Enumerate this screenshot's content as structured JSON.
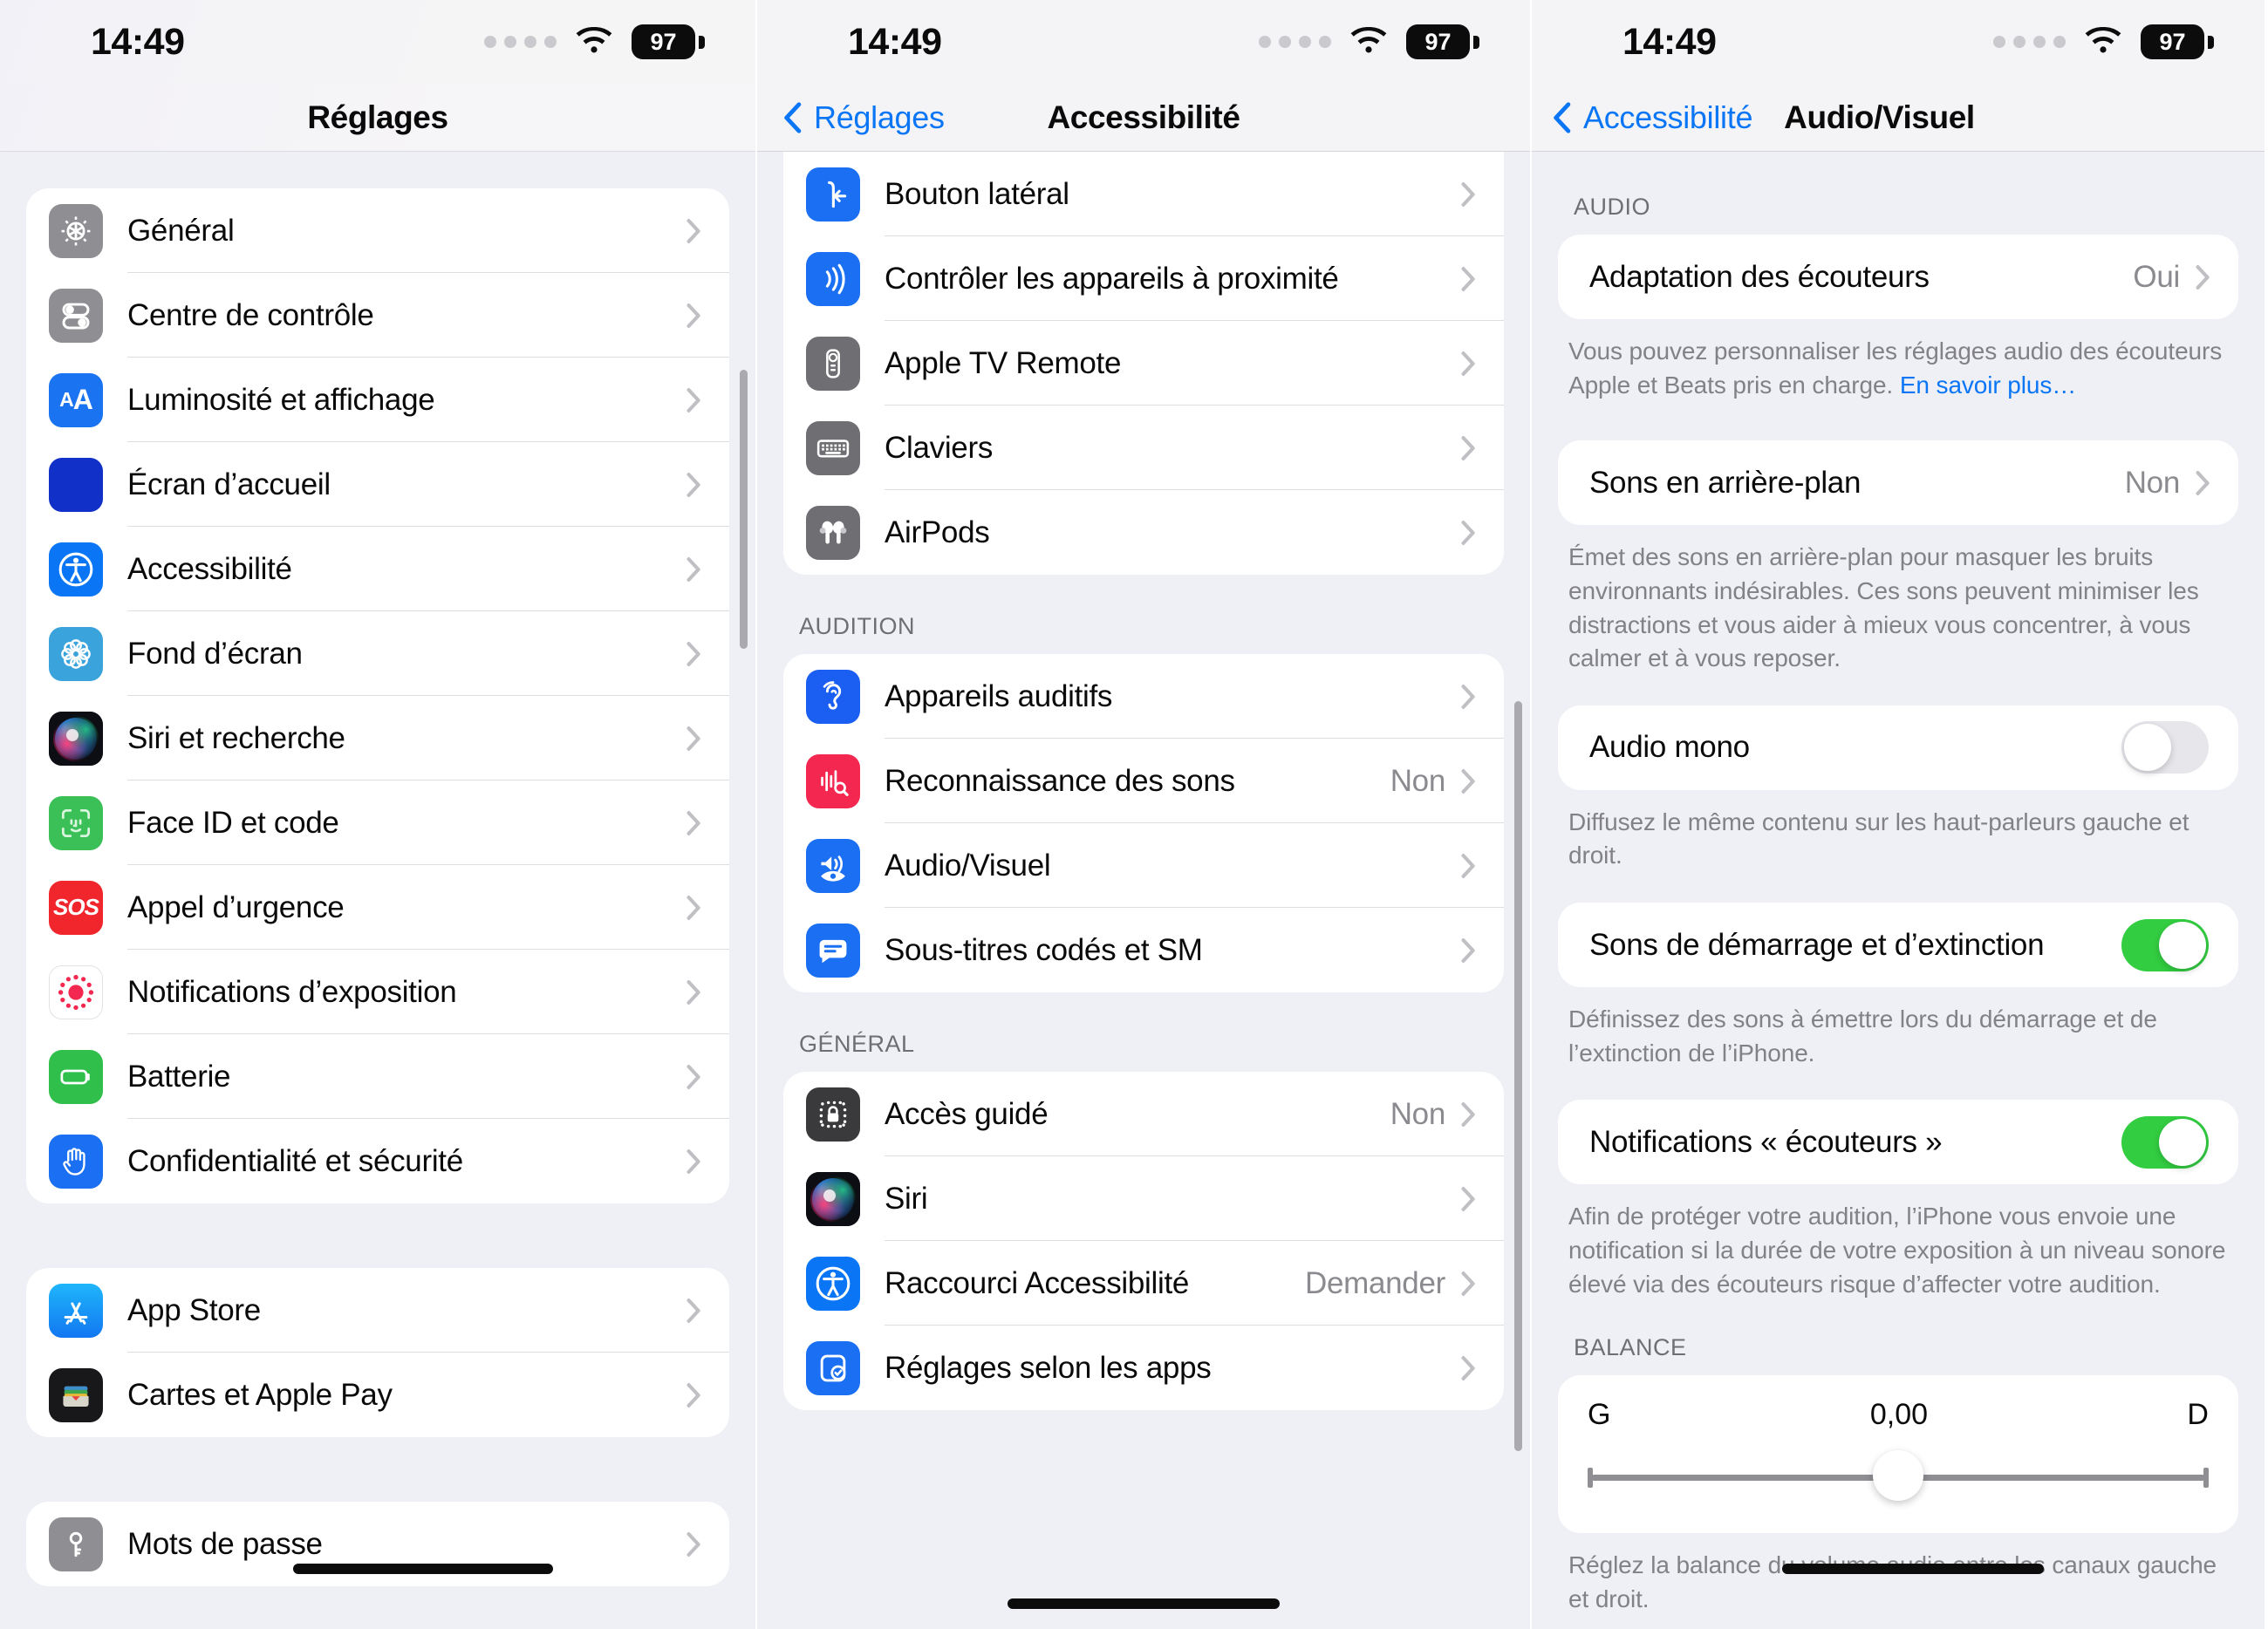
{
  "status": {
    "time": "14:49",
    "battery_percent": "97",
    "signal_dots": 4,
    "wifi_icon": "wifi-icon",
    "battery_icon": "battery-icon"
  },
  "screen1": {
    "nav": {
      "title": "Réglages"
    },
    "groups": [
      {
        "items": [
          {
            "label": "Général",
            "icon": "gear-icon",
            "icon_color": "#8e8e93"
          },
          {
            "label": "Centre de contrôle",
            "icon": "control-center-icon",
            "icon_color": "#8e8e93"
          },
          {
            "label": "Luminosité et affichage",
            "icon": "display-brightness-icon",
            "icon_color": "#1a73f0"
          },
          {
            "label": "Écran d’accueil",
            "icon": "home-screen-icon",
            "icon_color": "#1130c8"
          },
          {
            "label": "Accessibilité",
            "icon": "accessibility-icon",
            "icon_color": "#0a76f6"
          },
          {
            "label": "Fond d’écran",
            "icon": "wallpaper-icon",
            "icon_color": "#3aa3dc"
          },
          {
            "label": "Siri et recherche",
            "icon": "siri-icon",
            "icon_color": "#1c1c20"
          },
          {
            "label": "Face ID et code",
            "icon": "face-id-icon",
            "icon_color": "#3ac057"
          },
          {
            "label": "Appel d’urgence",
            "icon": "sos-icon",
            "icon_color": "#f0262c"
          },
          {
            "label": "Notifications d’exposition",
            "icon": "exposure-notifications-icon",
            "icon_color": "#ffffff"
          },
          {
            "label": "Batterie",
            "icon": "battery-settings-icon",
            "icon_color": "#2fbf4a"
          },
          {
            "label": "Confidentialité et sécurité",
            "icon": "privacy-hand-icon",
            "icon_color": "#1a6ff2"
          }
        ]
      },
      {
        "items": [
          {
            "label": "App Store",
            "icon": "app-store-icon",
            "icon_color": "#1d9bf5"
          },
          {
            "label": "Cartes et Apple Pay",
            "icon": "wallet-icon",
            "icon_color": "#1c1c1e"
          }
        ]
      },
      {
        "items": [
          {
            "label": "Mots de passe",
            "icon": "passwords-key-icon",
            "icon_color": "#8e8e93"
          }
        ]
      }
    ]
  },
  "screen2": {
    "nav": {
      "back": "Réglages",
      "title": "Accessibilité"
    },
    "group_top": {
      "items": [
        {
          "label": "Bouton latéral",
          "icon": "side-button-icon",
          "icon_color": "#1a6ff2"
        },
        {
          "label": "Contrôler les appareils à proximité",
          "icon": "nearby-devices-icon",
          "icon_color": "#1a6ff2"
        },
        {
          "label": "Apple TV Remote",
          "icon": "apple-tv-remote-icon",
          "icon_color": "#6e6e73"
        },
        {
          "label": "Claviers",
          "icon": "keyboard-icon",
          "icon_color": "#6e6e73"
        },
        {
          "label": "AirPods",
          "icon": "airpods-icon",
          "icon_color": "#6e6e73"
        }
      ]
    },
    "section_audition": {
      "header": "AUDITION",
      "items": [
        {
          "label": "Appareils auditifs",
          "value": "",
          "icon": "hearing-ear-icon",
          "icon_color": "#1a5ef2"
        },
        {
          "label": "Reconnaissance des sons",
          "value": "Non",
          "icon": "sound-recognition-icon",
          "icon_color": "#f3274f"
        },
        {
          "label": "Audio/Visuel",
          "value": "",
          "icon": "audio-visual-icon",
          "icon_color": "#1a6ff2"
        },
        {
          "label": "Sous-titres codés et SM",
          "value": "",
          "icon": "subtitles-icon",
          "icon_color": "#1a6ff2"
        }
      ]
    },
    "section_general": {
      "header": "GÉNÉRAL",
      "items": [
        {
          "label": "Accès guidé",
          "value": "Non",
          "icon": "guided-access-lock-icon",
          "icon_color": "#3a3a3c"
        },
        {
          "label": "Siri",
          "value": "",
          "icon": "siri-icon",
          "icon_color": "#1c1c20"
        },
        {
          "label": "Raccourci Accessibilité",
          "value": "Demander",
          "icon": "accessibility-icon",
          "icon_color": "#0a76f6"
        },
        {
          "label": "Réglages selon les apps",
          "value": "",
          "icon": "per-app-settings-icon",
          "icon_color": "#1a6ff2"
        }
      ]
    }
  },
  "screen3": {
    "nav": {
      "back": "Accessibilité",
      "title": "Audio/Visuel"
    },
    "section_audio": {
      "header": "AUDIO",
      "headphone_row": {
        "label": "Adaptation des écouteurs",
        "value": "Oui"
      },
      "headphone_note": "Vous pouvez personnaliser les réglages audio des écouteurs Apple et Beats pris en charge.",
      "headphone_link": "En savoir plus…",
      "background_row": {
        "label": "Sons en arrière-plan",
        "value": "Non"
      },
      "background_note": "Émet des sons en arrière-plan pour masquer les bruits environnants indésirables. Ces sons peuvent minimiser les distractions et vous aider à mieux vous concentrer, à vous calmer et à vous reposer.",
      "mono_row": {
        "label": "Audio mono",
        "state": "off"
      },
      "mono_note": "Diffusez le même contenu sur les haut-parleurs gauche et droit.",
      "startup_row": {
        "label": "Sons de démarrage et d’extinction",
        "state": "on"
      },
      "startup_note": "Définissez des sons à émettre lors du démarrage et de l’extinction de l’iPhone.",
      "headphone_notif_row": {
        "label": "Notifications « écouteurs »",
        "state": "on"
      },
      "headphone_notif_note": "Afin de protéger votre audition, l’iPhone vous envoie une notification si la durée de votre exposition à un niveau sonore élevé via des écouteurs risque d’affecter votre audition."
    },
    "section_balance": {
      "header": "BALANCE",
      "left_label": "G",
      "right_label": "D",
      "value": "0,00",
      "note": "Réglez la balance du volume audio entre les canaux gauche et droit."
    }
  },
  "colors": {
    "accent_blue": "#0a76f6",
    "toggle_on_green": "#32cd41",
    "page_bg": "#eff0f5",
    "card_bg": "#ffffff",
    "secondary_text": "#8a8a8f"
  }
}
